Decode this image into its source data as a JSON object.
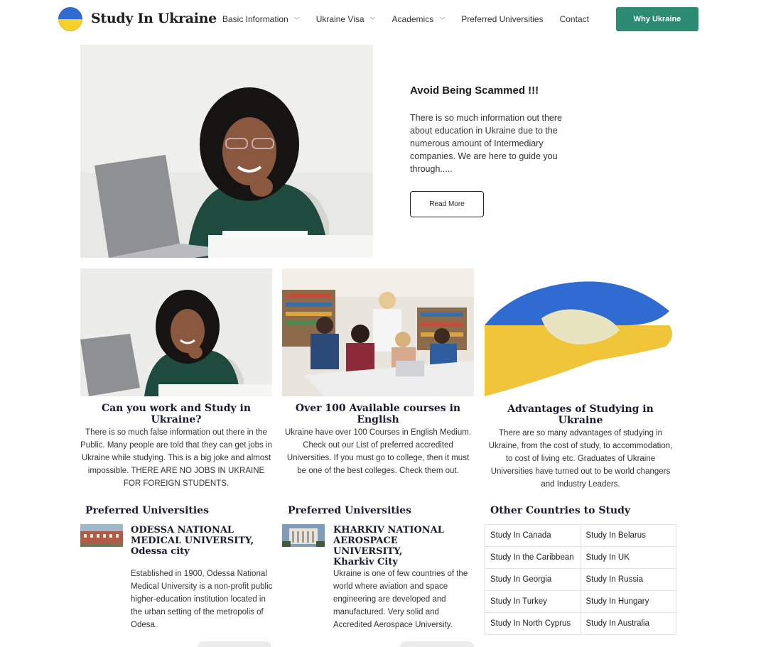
{
  "header": {
    "logo_text": "Study In Ukraine",
    "nav": [
      {
        "label": "Basic Information",
        "dropdown": true
      },
      {
        "label": "Ukraine Visa",
        "dropdown": true
      },
      {
        "label": "Academics",
        "dropdown": true
      },
      {
        "label": "Preferred Universities",
        "dropdown": false
      },
      {
        "label": "Contact",
        "dropdown": false
      }
    ],
    "cta_label": "Why Ukraine"
  },
  "hero": {
    "title": "Avoid Being Scammed !!!",
    "text": "There is so much information out there about education in Ukraine due to the numerous amount of Intermediary companies. We are here to guide you through.....",
    "button": "Read More"
  },
  "cards": [
    {
      "title": "Can you work and Study in Ukraine?",
      "text": "There is so much false information out there in the Public. Many people are told that they can get jobs in Ukraine while studying. This is a big joke and almost impossible. THERE ARE NO JOBS IN UKRAINE FOR FOREIGN STUDENTS."
    },
    {
      "title": "Over 100 Available courses in English",
      "text": "Ukraine have over 100 Courses in English Medium. Check out our List of preferred accredited Universities. If you must go to college, then it must be one of the best colleges. Check them out."
    },
    {
      "title": "Advantages of Studying in Ukraine",
      "text": "There are so many advantages of studying in Ukraine, from the cost of study, to accommodation, to cost of living etc. Graduates of Ukraine Universities have turned out to be world changers and Industry Leaders."
    }
  ],
  "preferred": [
    {
      "section_title": "Preferred Universities",
      "name": "ODESSA NATIONAL MEDICAL UNIVERSITY,",
      "city": "Odessa city",
      "text": "Established in 1900, Odessa National Medical University is a non-profit public higher-education institution located in the urban setting of the metropolis of Odesa."
    },
    {
      "section_title": "Preferred Universities",
      "name": "KHARKIV NATIONAL AEROSPACE UNIVERSITY,",
      "city": "Kharkiv City",
      "text": "Ukraine is one of few countries of the world where aviation and space engineering are developed and manufactured. Very solid and Accredited Aerospace University."
    }
  ],
  "other_countries": {
    "title": "Other Countries to Study",
    "rows": [
      [
        "Study In Canada",
        "Study In Belarus"
      ],
      [
        "Study In the Caribbean",
        "Study In UK"
      ],
      [
        "Study In Georgia",
        "Study In Russia"
      ],
      [
        "Study In Turkey",
        "Study In Hungary"
      ],
      [
        "Study In North Cyprus",
        "Study In Australia"
      ]
    ]
  },
  "colors": {
    "accent": "#2e8b73",
    "flag_blue": "#2f6bd1",
    "flag_yellow": "#f5cf2a"
  }
}
